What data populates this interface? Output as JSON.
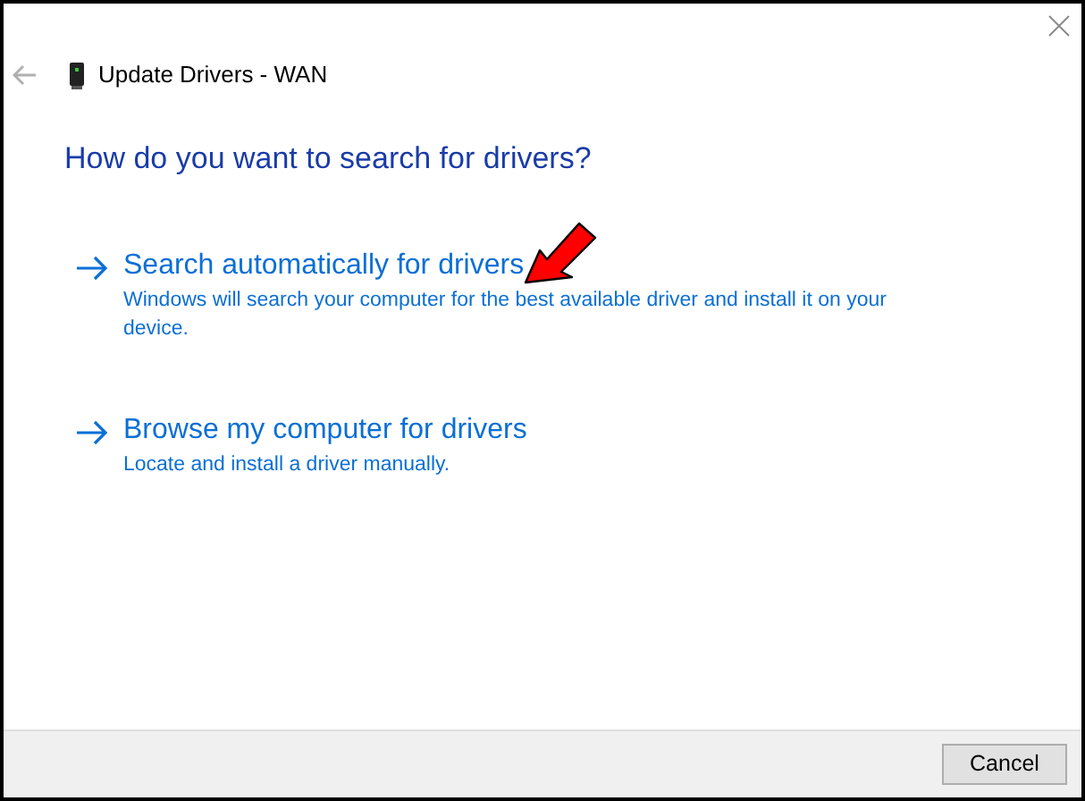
{
  "window": {
    "title": "Update Drivers - WAN"
  },
  "heading": "How do you want to search for drivers?",
  "options": [
    {
      "title": "Search automatically for drivers",
      "description": "Windows will search your computer for the best available driver and install it on your device."
    },
    {
      "title": "Browse my computer for drivers",
      "description": "Locate and install a driver manually."
    }
  ],
  "buttons": [
    "Cancel"
  ]
}
